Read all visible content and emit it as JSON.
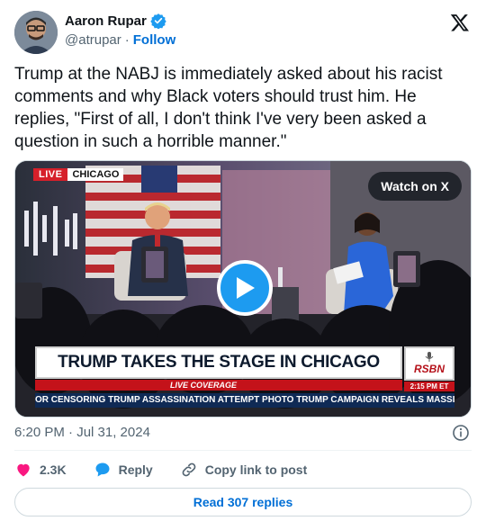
{
  "author": {
    "name": "Aaron Rupar",
    "handle": "@atrupar",
    "separator": "·",
    "follow_label": "Follow",
    "verified_icon": "verified-badge-icon",
    "verified_color": "#1d9bf0"
  },
  "tweet": {
    "text": "Trump at the NABJ is immediately asked about his racist comments and why Black voters should trust him. He replies, \"First of all, I don't think I've very been asked a question in such a horrible manner.\""
  },
  "media": {
    "live_label": "LIVE",
    "city_label": "CHICAGO",
    "watch_label": "Watch on X",
    "play_icon": "play-icon",
    "headline": "TRUMP TAKES THE STAGE IN CHICAGO",
    "subbar": "LIVE COVERAGE",
    "network": "RSBN",
    "network_time": "2:15 PM ET",
    "ticker": "OR CENSORING TRUMP ASSASSINATION ATTEMPT PHOTO    TRUMP CAMPAIGN REVEALS MASSIVE"
  },
  "meta": {
    "timestamp": "6:20 PM · Jul 31, 2024"
  },
  "actions": {
    "likes": "2.3K",
    "reply_label": "Reply",
    "copy_label": "Copy link to post",
    "like_color": "#f91880",
    "reply_color": "#1d9bf0"
  },
  "footer": {
    "read_replies": "Read 307 replies"
  }
}
